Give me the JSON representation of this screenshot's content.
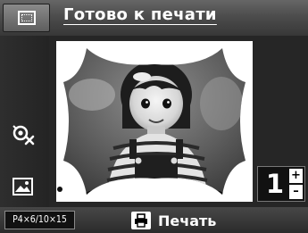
{
  "header": {
    "title": "Готово к печати",
    "frame_icon": "frame-layout-icon"
  },
  "sidebar": {
    "items": [
      {
        "icon": "red-eye-off-icon"
      },
      {
        "icon": "photo-enhance-icon"
      }
    ]
  },
  "preview": {
    "image": "photo-of-child-with-scalloped-frame",
    "frame_shape": "scalloped-corners"
  },
  "copies": {
    "value": "1",
    "increment_label": "+",
    "decrement_label": "–"
  },
  "footer": {
    "paper_size": "P4×6/10×15",
    "print_label": "Печать",
    "print_icon": "print-icon"
  }
}
